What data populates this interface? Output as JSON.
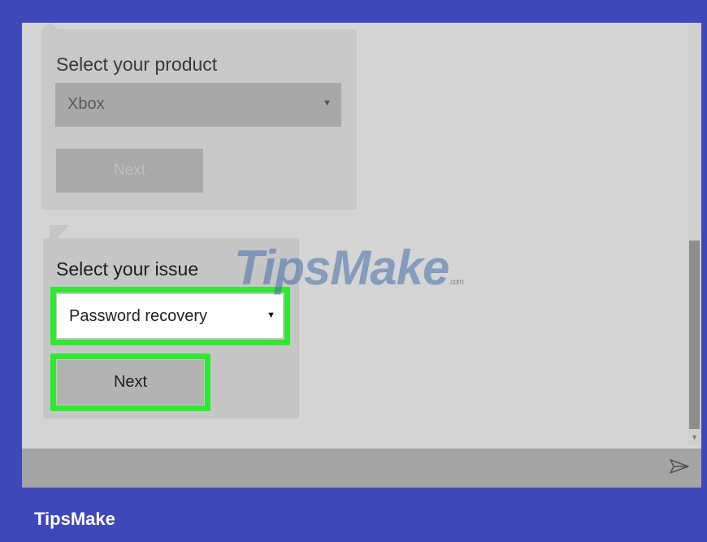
{
  "product_card": {
    "title": "Select your product",
    "selected_product": "Xbox",
    "next_label": "Next"
  },
  "issue_card": {
    "title": "Select your issue",
    "selected_issue": "Password recovery",
    "next_label": "Next"
  },
  "watermark": {
    "main": "TipsMake",
    "suffix": ".com"
  },
  "footer": {
    "brand": "TipsMake"
  },
  "icons": {
    "send": "send-icon",
    "dropdown": "caret-down-icon"
  },
  "colors": {
    "frame": "#3f48b8",
    "highlight": "#2ee832"
  }
}
